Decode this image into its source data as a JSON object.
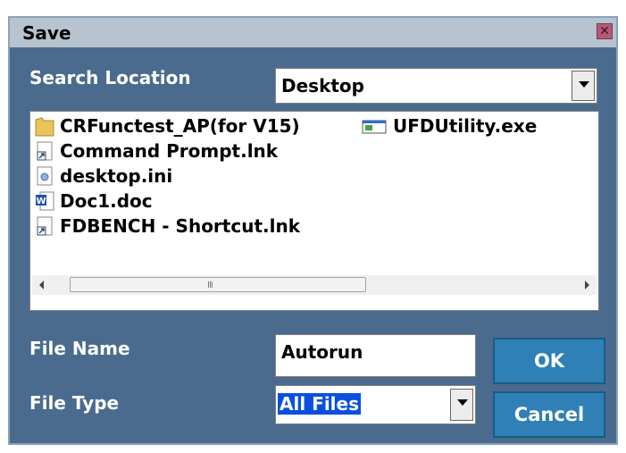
{
  "dialog": {
    "title": "Save"
  },
  "search_location": {
    "label": "Search Location",
    "value": "Desktop"
  },
  "files": [
    {
      "name": "CRFunctest_AP(for V15)",
      "icon": "folder-icon"
    },
    {
      "name": "UFDUtility.exe",
      "icon": "app-exe-icon"
    },
    {
      "name": "Command Prompt.lnk",
      "icon": "shortcut-icon"
    },
    {
      "name": "desktop.ini",
      "icon": "settings-file-icon"
    },
    {
      "name": "Doc1.doc",
      "icon": "word-document-icon"
    },
    {
      "name": "FDBENCH - Shortcut.lnk",
      "icon": "shortcut-icon"
    }
  ],
  "file_name": {
    "label": "File Name",
    "value": "Autorun"
  },
  "file_type": {
    "label": "File Type",
    "value": "All Files"
  },
  "buttons": {
    "ok": "OK",
    "cancel": "Cancel"
  },
  "scrollbar": {
    "grip": "III"
  },
  "colors": {
    "dialog_bg": "#4a6b8e",
    "title_bg": "#b7c3ce",
    "button_bg": "#2e80b6",
    "selection": "#0a4fe0"
  }
}
